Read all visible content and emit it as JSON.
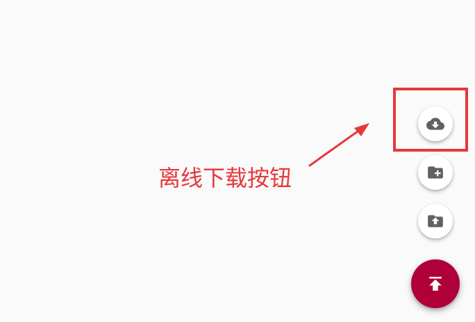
{
  "annotation": {
    "label": "离线下载按钮",
    "color": "#e8373b"
  },
  "fab_menu": {
    "items": [
      {
        "icon": "cloud-download-icon"
      },
      {
        "icon": "create-folder-icon"
      },
      {
        "icon": "upload-folder-icon"
      }
    ],
    "main": {
      "icon": "upload-icon",
      "color": "#b0003a"
    }
  }
}
